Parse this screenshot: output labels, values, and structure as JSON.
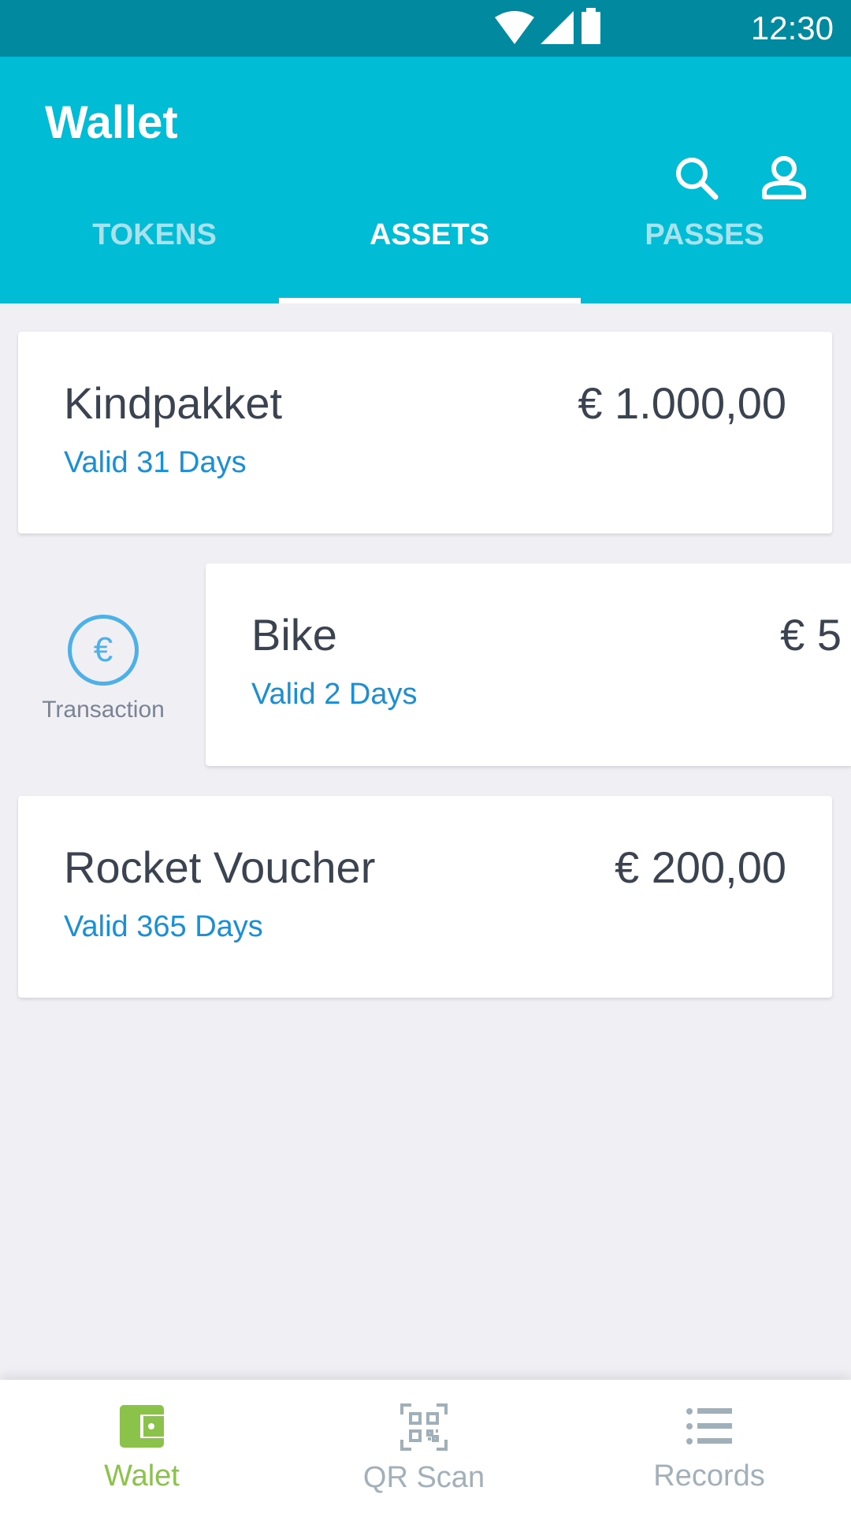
{
  "status_bar": {
    "time": "12:30"
  },
  "app_bar": {
    "title": "Wallet",
    "search_icon": "search-icon",
    "profile_icon": "person-icon"
  },
  "tabs": [
    {
      "label": "TOKENS",
      "active": false
    },
    {
      "label": "ASSETS",
      "active": true
    },
    {
      "label": "PASSES",
      "active": false
    }
  ],
  "assets": [
    {
      "name": "Kindpakket",
      "amount": "€ 1.000,00",
      "validity": "Valid 31 Days"
    },
    {
      "name": "Bike",
      "amount": "€ 5",
      "validity": "Valid 2 Days"
    },
    {
      "name": "Rocket Voucher",
      "amount": "€ 200,00",
      "validity": "Valid 365 Days"
    }
  ],
  "swipe_action": {
    "icon": "€",
    "label": "Transaction"
  },
  "bottom_nav": [
    {
      "label": "Walet",
      "active": true
    },
    {
      "label": "QR Scan",
      "active": false
    },
    {
      "label": "Records",
      "active": false
    }
  ],
  "colors": {
    "primary": "#00bcd4",
    "status_bar": "#00899f",
    "accent_green": "#8bc34a",
    "link_blue": "#1a8fd4"
  }
}
